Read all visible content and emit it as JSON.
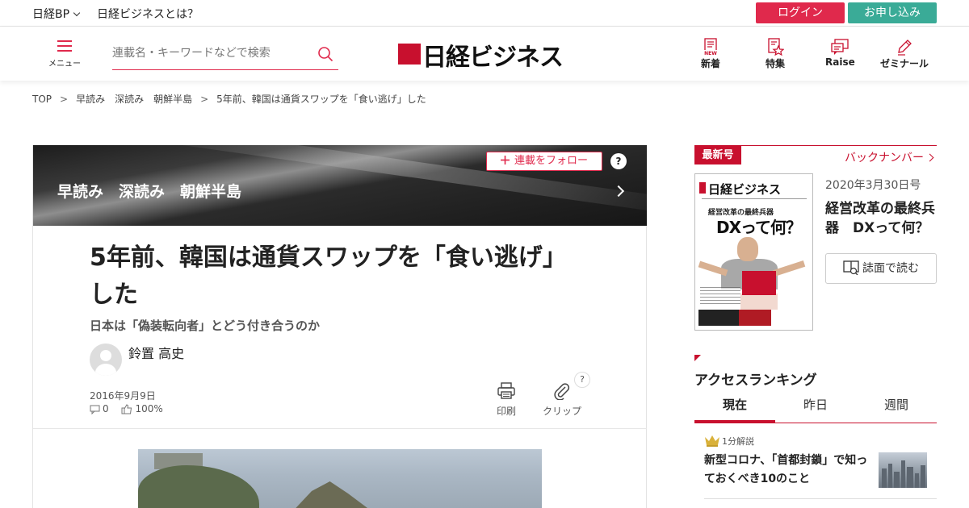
{
  "topbar": {
    "bp_label": "日経BP",
    "about_label": "日経ビジネスとは？",
    "login_label": "ログイン",
    "signup_label": "お申し込み",
    "login_color": "#e0294c",
    "signup_color": "#3aab97"
  },
  "header": {
    "menu_label": "メニュー",
    "search_placeholder": "連載名・キーワードなどで検索",
    "logo_text": "日経ビジネス",
    "nav": [
      {
        "label": "新着",
        "icon": "new-icon"
      },
      {
        "label": "特集",
        "icon": "star-document-icon"
      },
      {
        "label": "Raise",
        "icon": "speech-bubble-icon"
      },
      {
        "label": "ゼミナール",
        "icon": "pen-icon"
      }
    ]
  },
  "breadcrumb": {
    "items": [
      "TOP",
      "早読み　深読み　朝鮮半島",
      "5年前、韓国は通貨スワップを「食い逃げ」した"
    ],
    "separator": ">"
  },
  "series": {
    "title": "早読み　深読み　朝鮮半島",
    "follow_label": "連載をフォロー",
    "help_label": "?"
  },
  "article": {
    "title": "5年前、韓国は通貨スワップを「食い逃げ」した",
    "subtitle": "日本は「偽装転向者」とどう付き合うのか",
    "author": "鈴置 高史",
    "date": "2016年9月9日",
    "comments": "0",
    "like_pct": "100%",
    "print_label": "印刷",
    "clip_label": "クリップ",
    "clip_help": "?"
  },
  "sidebar": {
    "newest_label": "最新号",
    "backnumber_label": "バックナンバー",
    "issue_date": "2020年3月30日号",
    "issue_title": "経営改革の最終兵器　DXって何？",
    "read_label": "誌面で読む",
    "cover": {
      "masthead": "日経ビジネス",
      "kicker": "経営改革の最終兵器",
      "headline": "DXって何？"
    },
    "ranking": {
      "title": "アクセスランキング",
      "tabs": [
        "現在",
        "昨日",
        "週間"
      ],
      "active_tab": 0,
      "items": [
        {
          "tag": "1分解説",
          "title": "新型コロナ、「首都封鎖」で知っておくべき10のこと"
        }
      ]
    },
    "accent_color": "#c8102e"
  }
}
